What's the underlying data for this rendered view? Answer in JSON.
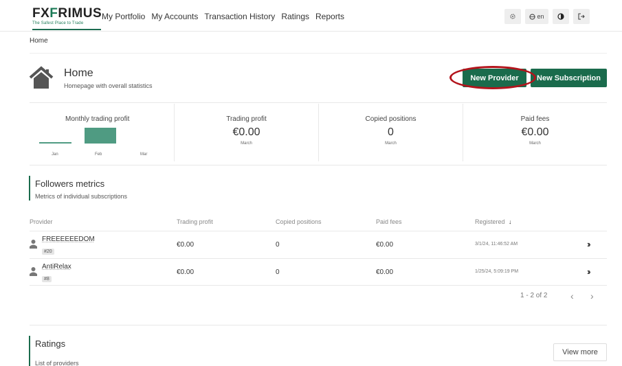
{
  "brand": {
    "name_part1": "FX",
    "name_accent": "F",
    "name_part2": "RIMUS",
    "tagline": "The Safest Place to Trade"
  },
  "nav": {
    "items": [
      "My Portfolio",
      "My Accounts",
      "Transaction History",
      "Ratings",
      "Reports"
    ],
    "tools": {
      "settings_icon": "gear-icon",
      "language": "en",
      "theme_icon": "contrast-icon",
      "logout_icon": "logout-icon"
    }
  },
  "breadcrumb": "Home",
  "header": {
    "title": "Home",
    "subtitle": "Homepage with overall statistics",
    "new_provider": "New Provider",
    "new_subscription": "New Subscription"
  },
  "stats": {
    "monthly_profit": {
      "title": "Monthly trading profit",
      "months": [
        "Jan",
        "Feb",
        "Mar"
      ]
    },
    "cards": [
      {
        "title": "Trading profit",
        "value": "€0.00",
        "period": "March"
      },
      {
        "title": "Copied positions",
        "value": "0",
        "period": "March"
      },
      {
        "title": "Paid fees",
        "value": "€0.00",
        "period": "March"
      }
    ]
  },
  "followers": {
    "title": "Followers metrics",
    "subtitle": "Metrics of individual subscriptions",
    "columns": [
      "Provider",
      "Trading profit",
      "Copied positions",
      "Paid fees",
      "Registered"
    ],
    "rows": [
      {
        "provider": "FREEEEEEDOM",
        "badge": "#20",
        "profit": "€0.00",
        "positions": "0",
        "fees": "€0.00",
        "registered": "3/1/24, 11:46:52 AM"
      },
      {
        "provider": "AntiRelax",
        "badge": "#8",
        "profit": "€0.00",
        "positions": "0",
        "fees": "€0.00",
        "registered": "1/25/24, 5:09:19 PM"
      }
    ],
    "pagination": "1 - 2 of 2"
  },
  "ratings": {
    "title": "Ratings",
    "subtitle": "List of providers",
    "view_more": "View more"
  },
  "colors": {
    "accent": "#1a6b4c",
    "highlight": "#b3141c",
    "bar": "#4f9b82"
  }
}
